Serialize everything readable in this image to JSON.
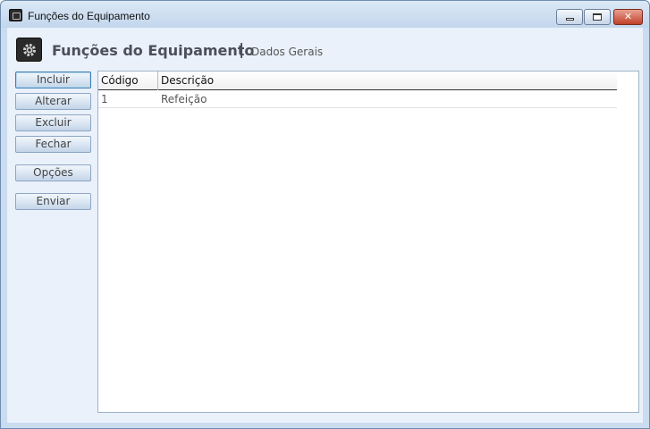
{
  "window": {
    "title": "Funções do Equipamento",
    "minimize_label": "",
    "maximize_label": "",
    "close_label": "✕"
  },
  "header": {
    "title": "Funções do Equipamento",
    "separator": "|",
    "subtitle": "Dados Gerais",
    "icon": "gear-icon"
  },
  "sidebar": {
    "buttons": [
      {
        "label": "Incluir"
      },
      {
        "label": "Alterar"
      },
      {
        "label": "Excluir"
      },
      {
        "label": "Fechar"
      },
      {
        "label": "Opções"
      },
      {
        "label": "Enviar"
      }
    ]
  },
  "grid": {
    "columns": [
      "Código",
      "Descrição"
    ],
    "rows": [
      [
        "1",
        "Refeição"
      ]
    ]
  }
}
